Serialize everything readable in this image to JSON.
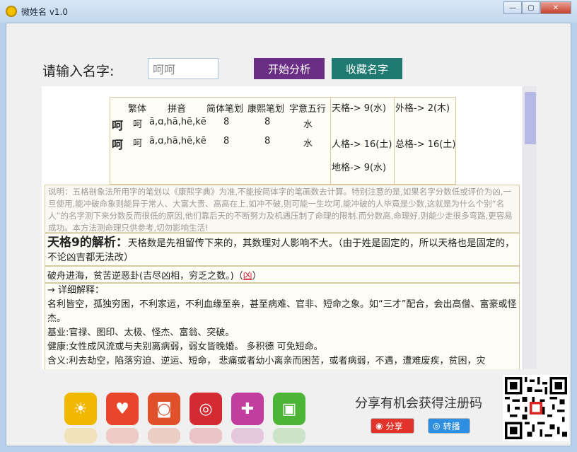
{
  "window": {
    "title": "微姓名 v1.0",
    "minimize": "—",
    "maximize": "▢",
    "close": "✕"
  },
  "form": {
    "label": "请输入名字:",
    "input_value": "呵呵",
    "analyze_button": "开始分析",
    "save_button": "收藏名字"
  },
  "table": {
    "headers": [
      "繁体",
      "拼音",
      "简体笔划",
      "康熙笔划",
      "字意五行"
    ],
    "rows": [
      {
        "char": "呵",
        "traditional": "呵",
        "pinyin": "ā,ɑ,hā,hē,kē",
        "simple_strokes": "8",
        "kangxi_strokes": "8",
        "element": "水"
      },
      {
        "char": "呵",
        "traditional": "呵",
        "pinyin": "ā,ɑ,hā,hē,kē",
        "simple_strokes": "8",
        "kangxi_strokes": "8",
        "element": "水"
      }
    ],
    "grids": {
      "tian": "天格-> 9(水)",
      "wai": "外格-> 2(木)",
      "ren": "人格-> 16(土)",
      "zong": "总格-> 16(土)",
      "di": "地格-> 9(水)"
    }
  },
  "notice": "说明：五格剖象法所用字的笔划以《康熙字典》为准,不能按简体字的笔画数去计算。特别注意的是,如果名字分数低或评价为凶,一旦使用,能冲破命象则能异于常人、大富大贵、高高在上,如冲不破,则可能一生坎坷,能冲破的人毕竟是少数,这就是为什么个别“名人”的名字测下来分数反而很低的原因,他们靠后天的不断努力及机遇压制了命理的限制.而分数高,命理好,则能少走很多弯路,更容易成功。本方法测命理只供参考,切勿影响生活!",
  "analysis": {
    "heading": "天格9的解析：",
    "intro": "天格数是先祖留传下来的，其数理对人影响不大。（由于姓是固定的，所以天格也是固定的，不论凶吉都无法改）",
    "fortune_prefix": "破舟进海，贫苦逆恶卦(吉尽凶相，穷乏之数。)（",
    "fortune_tag": "凶",
    "fortune_suffix": "）",
    "detail_title": "→ 详细解释：",
    "detail_1": "名利皆空，孤独穷困，不利家运，不利血缘至亲，甚至病难、官非、短命之象。如“三才”配合，会出高僧、富豪或怪杰。",
    "detail_2": "基业:官禄、图印、太极、怪杰、富翁、突破。",
    "detail_3": "健康:女性成风流或与夫别离病弱，弱女皆晚婚。 多积德 可免短命。",
    "detail_4": "含义:利去劫空，陷落穷迫、逆运、短命， 悲痛或者幼小离亲而困苦，或者病弱，不遇，遭难废疾，贫困，灾"
  },
  "footer": {
    "share_text": "分享有机会获得注册码",
    "share_weibo": "分享",
    "share_qq": "转播",
    "apps": [
      "sun-app-icon",
      "bird-app-icon",
      "camera-app-icon",
      "browser-app-icon",
      "gamepad-app-icon",
      "contacts-app-icon"
    ],
    "app_colors": [
      "#f0b800",
      "#e8452c",
      "#e0502a",
      "#d42a32",
      "#c13d9e",
      "#4cb538"
    ]
  }
}
